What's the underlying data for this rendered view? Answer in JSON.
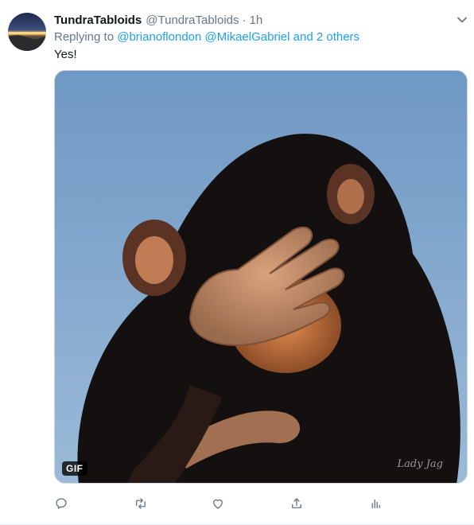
{
  "tweet": {
    "display_name": "TundraTabloids",
    "handle": "@TundraTabloids",
    "separator": "·",
    "time": "1h",
    "replying_prefix": "Replying to",
    "mention_1": "@brianoflondon",
    "mention_2": "@MikaelGabriel",
    "and_text": "and",
    "others": "2 others",
    "text": "Yes!"
  },
  "media": {
    "badge": "GIF",
    "watermark": "Lady Jag",
    "subject_icon": "chimp-facepalm-image"
  },
  "actions": [
    {
      "name": "reply-icon"
    },
    {
      "name": "retweet-icon"
    },
    {
      "name": "like-icon"
    },
    {
      "name": "share-icon"
    },
    {
      "name": "analytics-icon"
    }
  ],
  "colors": {
    "accent": "#1da1f2",
    "secondary_text": "#657786",
    "primary_text": "#14171a",
    "icon": "#657786"
  }
}
